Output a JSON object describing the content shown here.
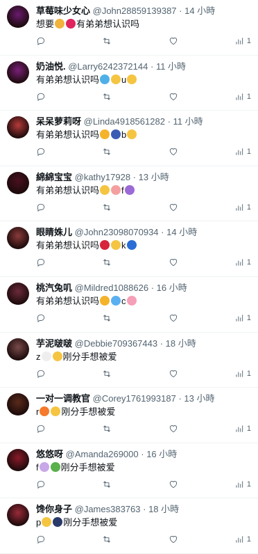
{
  "tweets": [
    {
      "name": "草莓味少女心",
      "handle": "@John28859139387",
      "time": "14 小時",
      "text": "想要",
      "emojis": [
        "#f2b33d",
        "#e0245e"
      ],
      "text2": "有弟弟想认识吗",
      "emojis2": [],
      "tail": "",
      "views": "1",
      "avatar": "#6a1b6e"
    },
    {
      "name": "奶油悦.",
      "handle": "@Larry6242372144",
      "time": "11 小時",
      "text": "有弟弟想认识吗",
      "emojis": [
        "#4fb0e8",
        "#f5c542"
      ],
      "text2": "u",
      "emojis2": [
        "#f5c542"
      ],
      "tail": "",
      "views": "1",
      "avatar": "#7a1f7a"
    },
    {
      "name": "呆呆萝莉呀",
      "handle": "@Linda4918561282",
      "time": "11 小時",
      "text": "有弟弟想认识吗",
      "emojis": [
        "#f5b32b",
        "#3b5bb5"
      ],
      "text2": "b",
      "emojis2": [
        "#f5c542"
      ],
      "tail": "",
      "views": "1",
      "avatar": "#b53a3a"
    },
    {
      "name": "綿綿宝宝",
      "handle": "@kathy17928",
      "time": "13 小時",
      "text": "有弟弟想认识吗",
      "emojis": [
        "#f5c542",
        "#f5a0a0"
      ],
      "text2": "f",
      "emojis2": [
        "#9b6ad6"
      ],
      "tail": "",
      "views": "1",
      "avatar": "#4a1020"
    },
    {
      "name": "眼睛姝儿",
      "handle": "@John23098070934",
      "time": "14 小時",
      "text": "有弟弟想认识吗",
      "emojis": [
        "#d6243a",
        "#f5c542"
      ],
      "text2": "k",
      "emojis2": [
        "#2b6dd6"
      ],
      "tail": "",
      "views": "1",
      "avatar": "#8a3a3a"
    },
    {
      "name": "桃汽兔叽",
      "handle": "@Mildred1088626",
      "time": "16 小時",
      "text": "有弟弟想认识吗",
      "emojis": [
        "#f5b32b",
        "#5ab0f0"
      ],
      "text2": "c",
      "emojis2": [
        "#f5a0b8"
      ],
      "tail": "",
      "views": "1",
      "avatar": "#6b2a3a"
    },
    {
      "name": "芋泥啵啵",
      "handle": "@Debbie709367443",
      "time": "18 小時",
      "text": "z",
      "emojis": [
        "#eeeeee",
        "#f5c542"
      ],
      "text2": "刚分手想被爱",
      "emojis2": [],
      "tail": "",
      "views": "1",
      "avatar": "#7a4a4a"
    },
    {
      "name": "一对一调教官",
      "handle": "@Corey1761993187",
      "time": "13 小時",
      "text": "r",
      "emojis": [
        "#f57a2b",
        "#f5c542"
      ],
      "text2": "刚分手想被爱",
      "emojis2": [],
      "tail": "",
      "views": "1",
      "avatar": "#5a2a1a"
    },
    {
      "name": "悠悠呀",
      "handle": "@Amanda269000",
      "time": "16 小時",
      "text": "f",
      "emojis": [
        "#c8a8e8",
        "#5ab04a"
      ],
      "text2": "刚分手想被爱",
      "emojis2": [],
      "tail": "",
      "views": "1",
      "avatar": "#8a1a2a"
    },
    {
      "name": "馋你身子",
      "handle": "@James383763",
      "time": "18 小時",
      "text": "p",
      "emojis": [
        "#f5c542",
        "#2a3a6a"
      ],
      "text2": "刚分手想被爱",
      "emojis2": [],
      "tail": "",
      "views": "1",
      "avatar": "#9a2a3a"
    }
  ]
}
